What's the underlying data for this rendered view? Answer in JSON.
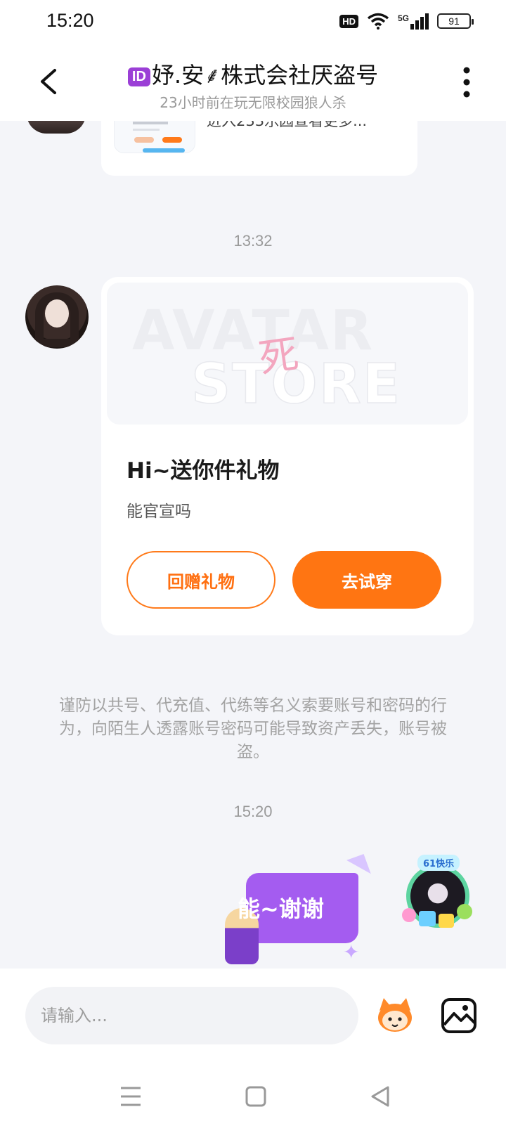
{
  "status_bar": {
    "time": "15:20",
    "hd_label": "HD",
    "network": "5G",
    "battery": "91",
    "icons": [
      "hd-icon",
      "wifi-icon",
      "signal-5g-icon",
      "battery-icon"
    ]
  },
  "header": {
    "id_badge": "ID",
    "title": "妤.安⸙株式会社厌盗号",
    "subtitle": "23小时前在玩无限校园狼人杀",
    "icons": [
      "back-arrow-icon",
      "more-vertical-icon"
    ]
  },
  "chat": {
    "previous_card": {
      "text": "进入233乐园查看更多..."
    },
    "messages": [
      {
        "timestamp": "13:32",
        "type": "gift_card",
        "banner_words": [
          "AVATAR",
          "STORE"
        ],
        "banner_glyph": "死",
        "title": "Hi~送你件礼物",
        "subtitle": "能官宣吗",
        "buttons": {
          "return_gift": "回赠礼物",
          "try_on": "去试穿"
        }
      }
    ],
    "warning": "谨防以共号、代充值、代练等名义索要账号和密码的行为，向陌生人透露账号密码可能导致资产丢失，账号被盗。",
    "second_timestamp": "15:20",
    "sticker": {
      "text": "能~谢谢"
    },
    "my_avatar": {
      "tag": "61快乐"
    }
  },
  "input_bar": {
    "placeholder": "请输入...",
    "icons": [
      "emoji-mascot-icon",
      "image-icon"
    ]
  },
  "nav_bar": {
    "icons": [
      "menu-lines-icon",
      "home-square-icon",
      "back-triangle-icon"
    ]
  },
  "colors": {
    "accent": "#ff7512",
    "id_badge": "#9b3fd6",
    "background": "#f4f5f9"
  }
}
